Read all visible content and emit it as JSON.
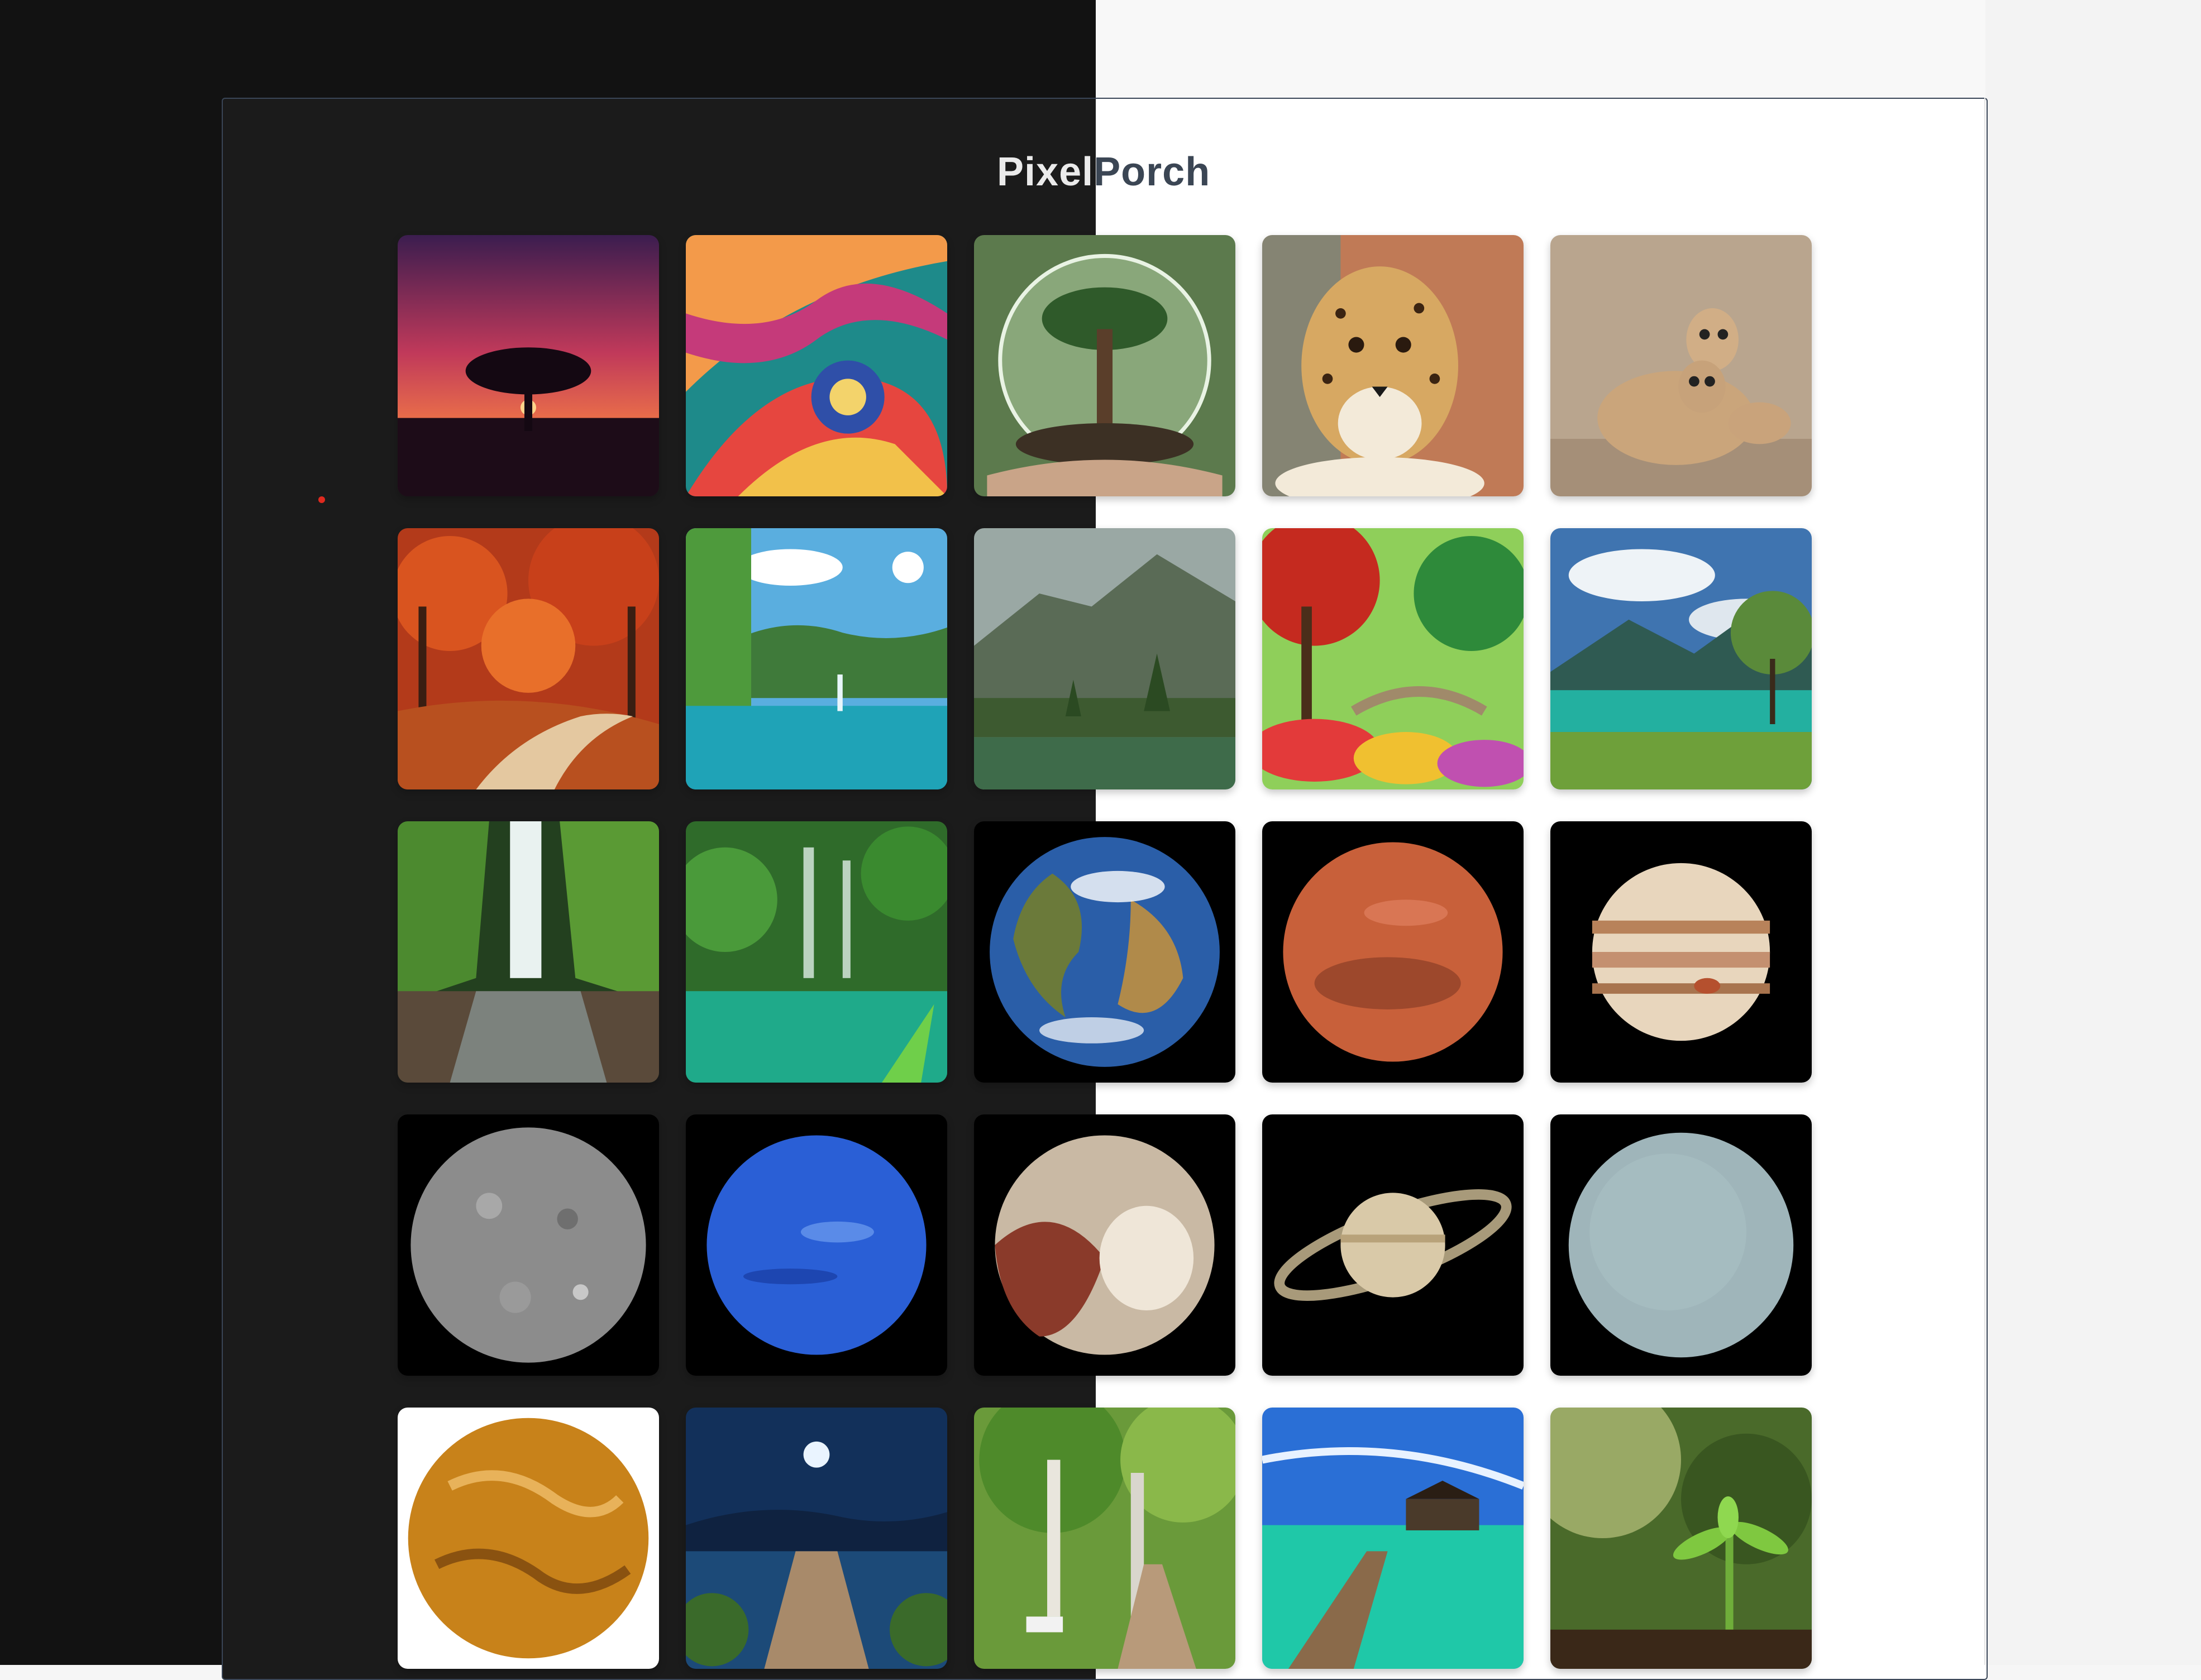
{
  "app": {
    "title_part1": "Pixel",
    "title_part2": "Porch"
  },
  "gallery": {
    "tiles": [
      {
        "icon": "sunset-tree-icon"
      },
      {
        "icon": "abstract-swirl-icon"
      },
      {
        "icon": "glass-globe-tree-icon"
      },
      {
        "icon": "cheetah-icon"
      },
      {
        "icon": "meerkats-icon"
      },
      {
        "icon": "autumn-forest-icon"
      },
      {
        "icon": "mountain-lake-icon"
      },
      {
        "icon": "misty-valley-icon"
      },
      {
        "icon": "fantasy-garden-icon"
      },
      {
        "icon": "alpine-lake-icon"
      },
      {
        "icon": "waterfall-canyon-icon"
      },
      {
        "icon": "jungle-waterfall-icon"
      },
      {
        "icon": "earth-icon"
      },
      {
        "icon": "mars-icon"
      },
      {
        "icon": "jupiter-icon"
      },
      {
        "icon": "mercury-icon"
      },
      {
        "icon": "neptune-icon"
      },
      {
        "icon": "pluto-icon"
      },
      {
        "icon": "saturn-icon"
      },
      {
        "icon": "uranus-icon"
      },
      {
        "icon": "venus-icon"
      },
      {
        "icon": "lake-pier-night-icon"
      },
      {
        "icon": "park-path-icon"
      },
      {
        "icon": "tropical-pier-icon"
      },
      {
        "icon": "seedling-icon"
      }
    ]
  }
}
